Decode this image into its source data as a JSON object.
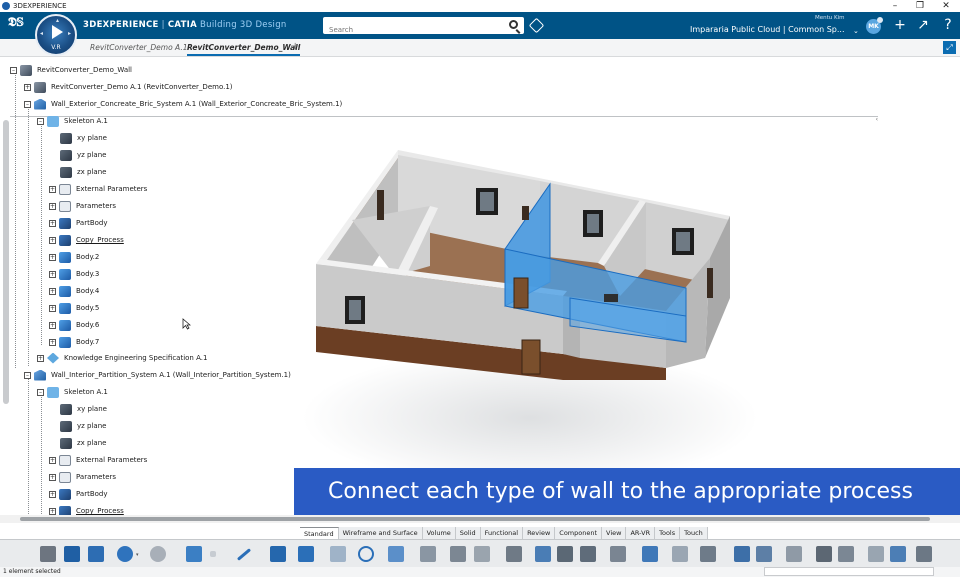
{
  "window": {
    "title": "3DEXPERIENCE"
  },
  "header": {
    "brand_left": "3DEXPERIENCE",
    "brand_sep": " | ",
    "brand_mid": "CATIA",
    "brand_app": " Building 3D Design",
    "compass_version": "V.R",
    "search_placeholder": "Search",
    "user_name": "Mentu Kim",
    "avatar_initials": "MK",
    "platform": "Impararia Public Cloud | Common Sp..."
  },
  "tabs": [
    {
      "label": "RevitConverter_Demo A.1"
    },
    {
      "label": "RevitConverter_Demo_Wall"
    }
  ],
  "tree": {
    "root": "RevitConverter_Demo_Wall",
    "items": [
      {
        "label": "RevitConverter_Demo A.1 (RevitConverter_Demo.1)"
      },
      {
        "label": "Wall_Exterior_Concreate_Bric_System A.1 (Wall_Exterior_Concreate_Bric_System.1)"
      },
      {
        "label": "Skeleton A.1"
      },
      {
        "label": "xy plane"
      },
      {
        "label": "yz plane"
      },
      {
        "label": "zx plane"
      },
      {
        "label": "External Parameters"
      },
      {
        "label": "Parameters"
      },
      {
        "label": "PartBody"
      },
      {
        "label": "Copy_Process"
      },
      {
        "label": "Body.2"
      },
      {
        "label": "Body.3"
      },
      {
        "label": "Body.4"
      },
      {
        "label": "Body.5"
      },
      {
        "label": "Body.6"
      },
      {
        "label": "Body.7"
      },
      {
        "label": "Knowledge Engineering Specification A.1"
      },
      {
        "label": "Wall_Interior_Partition_System A.1 (Wall_Interior_Partition_System.1)"
      },
      {
        "label": "Skeleton A.1"
      },
      {
        "label": "xy plane"
      },
      {
        "label": "yz plane"
      },
      {
        "label": "zx plane"
      },
      {
        "label": "External Parameters"
      },
      {
        "label": "Parameters"
      },
      {
        "label": "PartBody"
      },
      {
        "label": "Copy_Process"
      }
    ]
  },
  "caption": "Connect each type of wall to the appropriate process",
  "section_tabs": [
    "Standard",
    "Wireframe and Surface",
    "Volume",
    "Solid",
    "Functional",
    "Review",
    "Component",
    "View",
    "AR-VR",
    "Tools",
    "Touch"
  ],
  "status": {
    "text": "1 element selected"
  },
  "colors": {
    "topbar": "#005386",
    "accent": "#0b6cb1",
    "caption_bg": "#2a5bc4",
    "selected_wall": "#3f95e0"
  }
}
